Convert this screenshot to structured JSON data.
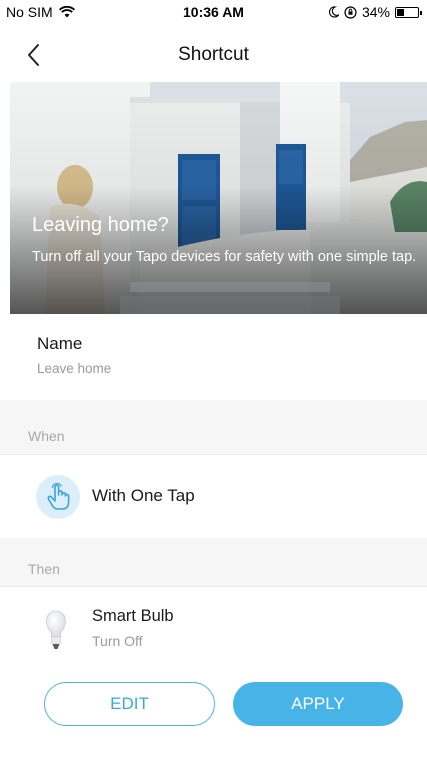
{
  "status_bar": {
    "carrier": "No SIM",
    "time": "10:36 AM",
    "battery_percent": "34%",
    "battery_level": 0.34
  },
  "nav": {
    "title": "Shortcut",
    "back_icon": "chevron-left-icon"
  },
  "hero": {
    "title": "Leaving home?",
    "description": "Turn off all your Tapo devices for safety with one simple tap."
  },
  "name_section": {
    "label": "Name",
    "value": "Leave home"
  },
  "when_section": {
    "header": "When",
    "trigger_label": "With One Tap",
    "trigger_icon": "tap-hand-icon"
  },
  "then_section": {
    "header": "Then",
    "device_name": "Smart Bulb",
    "device_action": "Turn Off",
    "device_icon": "bulb-icon"
  },
  "actions": {
    "edit_label": "EDIT",
    "apply_label": "APPLY"
  },
  "colors": {
    "accent": "#47b4e8",
    "door_blue": "#1f5a9a",
    "muted_text": "#9a9a9a"
  }
}
